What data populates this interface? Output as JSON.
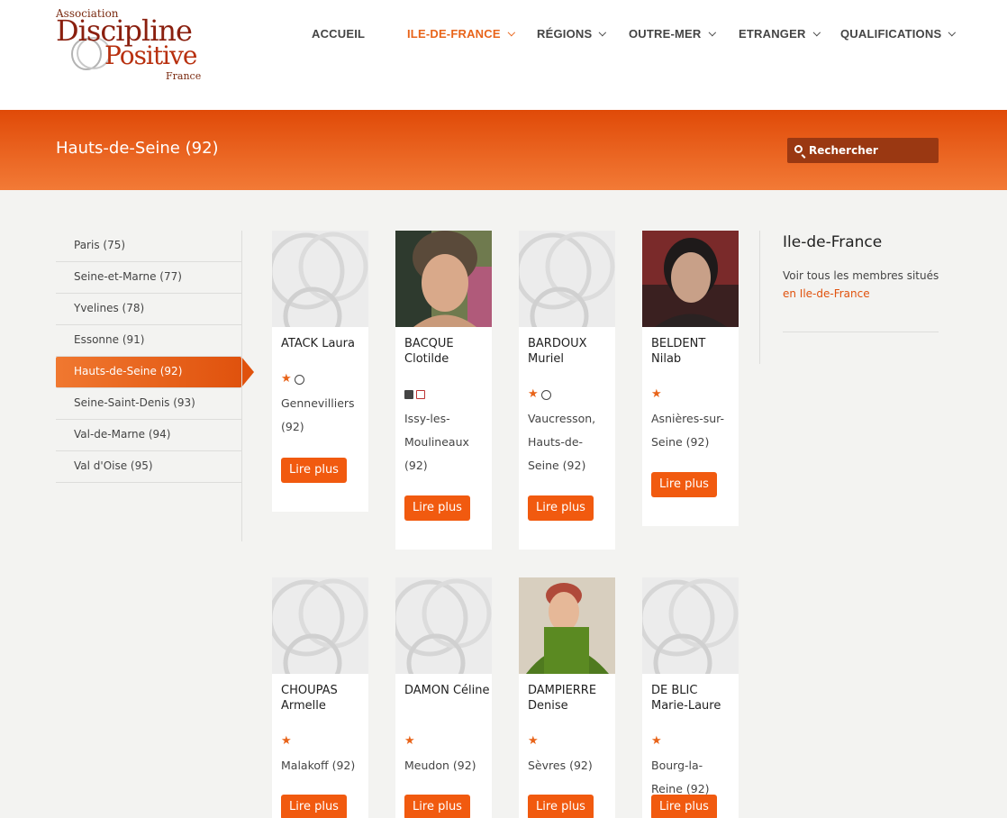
{
  "logo": {
    "association": "Association",
    "word1": "Discipline",
    "word2": "Positive",
    "country": "France"
  },
  "nav": [
    {
      "label": "ACCUEIL",
      "active": false,
      "has_dropdown": false
    },
    {
      "label": "ILE-DE-FRANCE",
      "active": true,
      "has_dropdown": true
    },
    {
      "label": "RÉGIONS",
      "active": false,
      "has_dropdown": true
    },
    {
      "label": "OUTRE-MER",
      "active": false,
      "has_dropdown": true
    },
    {
      "label": "ETRANGER",
      "active": false,
      "has_dropdown": true
    },
    {
      "label": "QUALIFICATIONS",
      "active": false,
      "has_dropdown": true
    }
  ],
  "banner": {
    "title": "Hauts-de-Seine (92)",
    "search_placeholder": "Rechercher",
    "search_icon": "search-icon"
  },
  "sidebar": {
    "items": [
      {
        "label": "Paris (75)",
        "active": false
      },
      {
        "label": "Seine-et-Marne (77)",
        "active": false
      },
      {
        "label": "Yvelines (78)",
        "active": false
      },
      {
        "label": "Essonne (91)",
        "active": false
      },
      {
        "label": "Hauts-de-Seine (92)",
        "active": true
      },
      {
        "label": "Seine-Saint-Denis (93)",
        "active": false
      },
      {
        "label": "Val-de-Marne (94)",
        "active": false
      },
      {
        "label": "Val d'Oise (95)",
        "active": false
      }
    ]
  },
  "members": [
    {
      "name": "ATACK Laura",
      "icons": [
        "star",
        "circle"
      ],
      "location": "Gennevilliers (92)",
      "photo": "placeholder",
      "button": "Lire plus"
    },
    {
      "name": "BACQUE Clotilde",
      "icons": [
        "square-dark",
        "square-red"
      ],
      "location": "Issy-les-Moulineaux (92)",
      "photo": "photo-woman-1",
      "button": "Lire plus"
    },
    {
      "name": "BARDOUX Muriel",
      "icons": [
        "star",
        "circle"
      ],
      "location": "Vaucresson, Hauts-de-Seine (92)",
      "photo": "placeholder",
      "button": "Lire plus"
    },
    {
      "name": "BELDENT Nilab",
      "icons": [
        "star"
      ],
      "location": "Asnières-sur-Seine (92)",
      "photo": "photo-woman-2",
      "button": "Lire plus"
    },
    {
      "name": "CHOUPAS Armelle",
      "icons": [
        "star"
      ],
      "location": "Malakoff (92)",
      "photo": "placeholder",
      "button": "Lire plus"
    },
    {
      "name": "DAMON Céline",
      "icons": [
        "star"
      ],
      "location": "Meudon (92)",
      "photo": "placeholder",
      "button": "Lire plus"
    },
    {
      "name": "DAMPIERRE Denise",
      "icons": [
        "star"
      ],
      "location": "Sèvres (92)",
      "photo": "photo-woman-3",
      "button": "Lire plus"
    },
    {
      "name": "DE BLIC Marie-Laure",
      "icons": [
        "star"
      ],
      "location": "Bourg-la-Reine (92)",
      "photo": "placeholder",
      "button": "Lire plus"
    }
  ],
  "right": {
    "title": "Ile-de-France",
    "text": "Voir tous les membres situés",
    "link": "en Ile-de-France"
  },
  "colors": {
    "accent": "#e8641a",
    "button": "#f15a0f",
    "banner_top": "#e04a08",
    "banner_bottom": "#f27a36",
    "search_bg": "#9a3812"
  }
}
